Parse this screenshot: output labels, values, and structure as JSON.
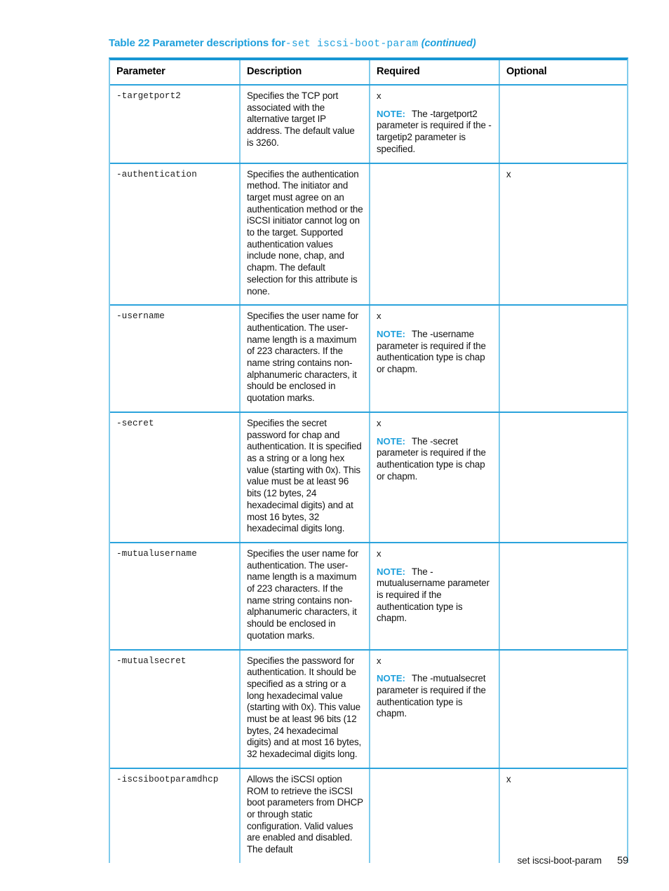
{
  "caption": {
    "prefix": "Table 22 Parameter descriptions for",
    "command": "-set iscsi-boot-param",
    "continued": "(continued)"
  },
  "accent_colors": {
    "title_blue": "#1FA0DC",
    "table_top_border": "#1896D3",
    "table_inner_border": "#7FCBEC",
    "row_border": "#2BA3DC",
    "note_label": "#1FA0DC"
  },
  "table": {
    "headers": [
      "Parameter",
      "Description",
      "Required",
      "Optional"
    ],
    "rows": [
      {
        "parameter": "-targetport2",
        "description": "Specifies the TCP port associated with the alternative target IP address. The default value is 3260.",
        "required_mark": "x",
        "required_note_label": "NOTE:",
        "required_note_text": "The -targetport2 parameter is required if the -targetip2  parameter is specified.",
        "optional_mark": ""
      },
      {
        "parameter": "-authentication",
        "description": "Specifies the authentication method. The initiator and target must agree on an authentication method or the iSCSI initiator cannot log on to the target. Supported authentication values include none, chap, and chapm. The default selection for this attribute is none.",
        "required_mark": "",
        "required_note_label": "",
        "required_note_text": "",
        "optional_mark": "x"
      },
      {
        "parameter": "-username",
        "description": "Specifies the user name for authentication. The user-name length is a maximum of 223 characters. If the name string contains non-alphanumeric characters, it should be enclosed in quotation marks.",
        "required_mark": "x",
        "required_note_label": "NOTE:",
        "required_note_text": "The -username parameter is required if the authentication type is chap or chapm.",
        "optional_mark": ""
      },
      {
        "parameter": "-secret",
        "description": "Specifies the secret password for chap and authentication. It is specified as a string or a long hex value (starting with 0x). This value must be at least 96 bits (12 bytes, 24 hexadecimal digits) and at most 16 bytes, 32 hexadecimal digits long.",
        "required_mark": "x",
        "required_note_label": "NOTE:",
        "required_note_text": "The -secret parameter is required if the authentication type is chap or chapm.",
        "optional_mark": ""
      },
      {
        "parameter": "-mutualusername",
        "description": "Specifies the user name for authentication. The user-name length is a maximum of 223 characters. If the name string contains non-alphanumeric characters, it should be enclosed in quotation marks.",
        "required_mark": "x",
        "required_note_label": "NOTE:",
        "required_note_text": "The -mutualusername parameter is required if the authentication type is chapm.",
        "optional_mark": ""
      },
      {
        "parameter": "-mutualsecret",
        "description": "Specifies the password for authentication. It should be specified as a string or a long hexadecimal value (starting with 0x). This value must be at least 96 bits (12 bytes, 24 hexadecimal digits) and at most 16 bytes, 32 hexadecimal digits long.",
        "required_mark": "x",
        "required_note_label": "NOTE:",
        "required_note_text": "The -mutualsecret parameter is required if the authentication type is chapm.",
        "optional_mark": ""
      },
      {
        "parameter": "-iscsibootparamdhcp",
        "description": "Allows the iSCSI option ROM to retrieve the iSCSI boot parameters from DHCP or through static configuration. Valid values are enabled and disabled. The default",
        "required_mark": "",
        "required_note_label": "",
        "required_note_text": "",
        "optional_mark": "x"
      }
    ]
  },
  "footer": {
    "running_head": "set iscsi-boot-param",
    "page_number": "59"
  }
}
